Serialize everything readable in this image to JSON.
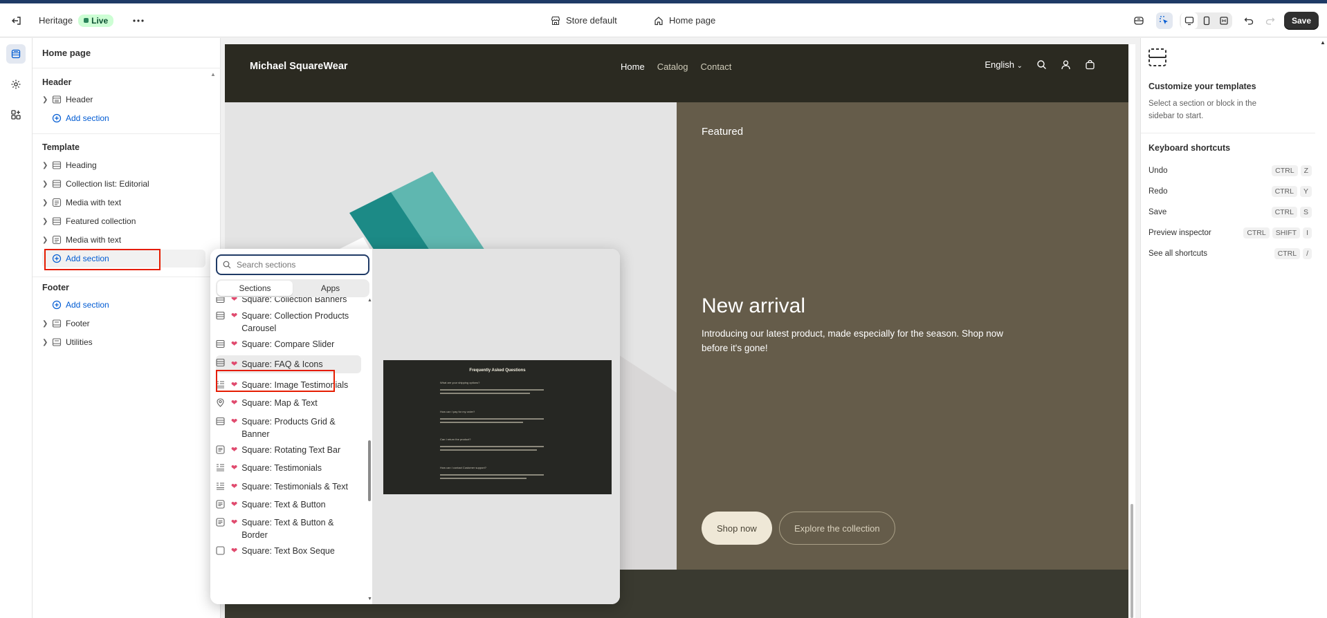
{
  "topbar": {
    "theme_name": "Heritage",
    "live_label": "Live",
    "store_selector": "Store default",
    "page_selector": "Home page",
    "save_label": "Save"
  },
  "sidebar": {
    "title": "Home page",
    "header_group": "Header",
    "header_items": [
      "Header"
    ],
    "header_add": "Add section",
    "template_group": "Template",
    "template_items": [
      "Heading",
      "Collection list: Editorial",
      "Media with text",
      "Featured collection",
      "Media with text"
    ],
    "template_add": "Add section",
    "footer_group": "Footer",
    "footer_add": "Add section",
    "footer_items": [
      "Footer",
      "Utilities"
    ]
  },
  "store": {
    "logo": "Michael SquareWear",
    "nav": [
      "Home",
      "Catalog",
      "Contact"
    ],
    "language": "English",
    "hero_label": "Featured",
    "hero_title": "New arrival",
    "hero_desc": "Introducing our latest product, made especially for the season. Shop now before it's gone!",
    "btn_primary": "Shop now",
    "btn_secondary": "Explore the collection"
  },
  "popover": {
    "search_placeholder": "Search sections",
    "tabs": [
      "Sections",
      "Apps"
    ],
    "items": [
      "Square: Collection Banners",
      "Square: Collection Products Carousel",
      "Square: Compare Slider",
      "Square: FAQ & Icons",
      "Square: Image Testimonials",
      "Square: Map & Text",
      "Square: Products Grid & Banner",
      "Square: Rotating Text Bar",
      "Square: Testimonials",
      "Square: Testimonials & Text",
      "Square: Text & Button",
      "Square: Text & Button & Border",
      "Square: Text Box Seque"
    ],
    "selected_item": "Square: FAQ & Icons",
    "preview": {
      "title": "Frequently Asked Questions",
      "questions": [
        "What are your shipping options?",
        "How can I pay for my order?",
        "Can I return the product?",
        "How can I contact Customer support?"
      ]
    }
  },
  "rightpanel": {
    "title": "Customize your templates",
    "desc": "Select a section or block in the sidebar to start.",
    "shortcuts_title": "Keyboard shortcuts",
    "shortcuts": [
      {
        "label": "Undo",
        "keys": [
          "CTRL",
          "Z"
        ]
      },
      {
        "label": "Redo",
        "keys": [
          "CTRL",
          "Y"
        ]
      },
      {
        "label": "Save",
        "keys": [
          "CTRL",
          "S"
        ]
      },
      {
        "label": "Preview inspector",
        "keys": [
          "CTRL",
          "SHIFT",
          "I"
        ]
      },
      {
        "label": "See all shortcuts",
        "keys": [
          "CTRL",
          "/"
        ]
      }
    ]
  },
  "colors": {
    "accent": "#005bd3",
    "highlight_red": "#e51c00",
    "live_green": "#cdfed4",
    "store_dark": "#2b2a21",
    "hero_brown": "#655c4a"
  }
}
